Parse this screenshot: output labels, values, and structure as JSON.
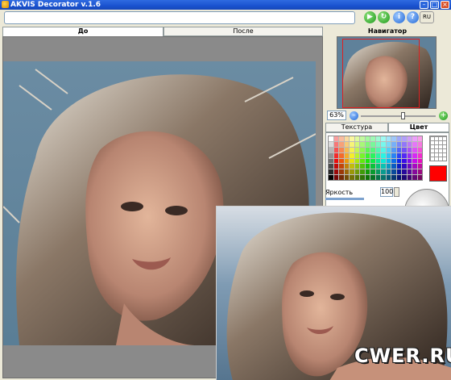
{
  "window": {
    "title": "AKVIS Decorator v.1.6"
  },
  "toolbar": {
    "path_value": "",
    "buttons": [
      {
        "name": "run-button",
        "icon": "play-icon",
        "glyph": "▶"
      },
      {
        "name": "refresh-button",
        "icon": "refresh-icon",
        "glyph": "↻"
      },
      {
        "name": "info-button",
        "icon": "info-icon",
        "glyph": "i"
      },
      {
        "name": "help-button",
        "icon": "help-icon",
        "glyph": "?"
      }
    ],
    "language": "RU"
  },
  "canvas": {
    "tabs": [
      {
        "label": "До",
        "active": true
      },
      {
        "label": "После",
        "active": false
      }
    ]
  },
  "navigator": {
    "title": "Навигатор",
    "zoom": "63%",
    "zoom_fraction": 0.55
  },
  "panel": {
    "tabs": [
      {
        "label": "Текстура",
        "active": false
      },
      {
        "label": "Цвет",
        "active": true
      }
    ],
    "selected_color": "#ff0000",
    "brightness_label": "Яркость",
    "brightness_value": "100"
  },
  "watermark": "CWER.RU",
  "colors": {
    "titlebar": "#1a52d0",
    "panel_bg": "#ece9d8",
    "photo_bg": "#6b8ca3"
  }
}
